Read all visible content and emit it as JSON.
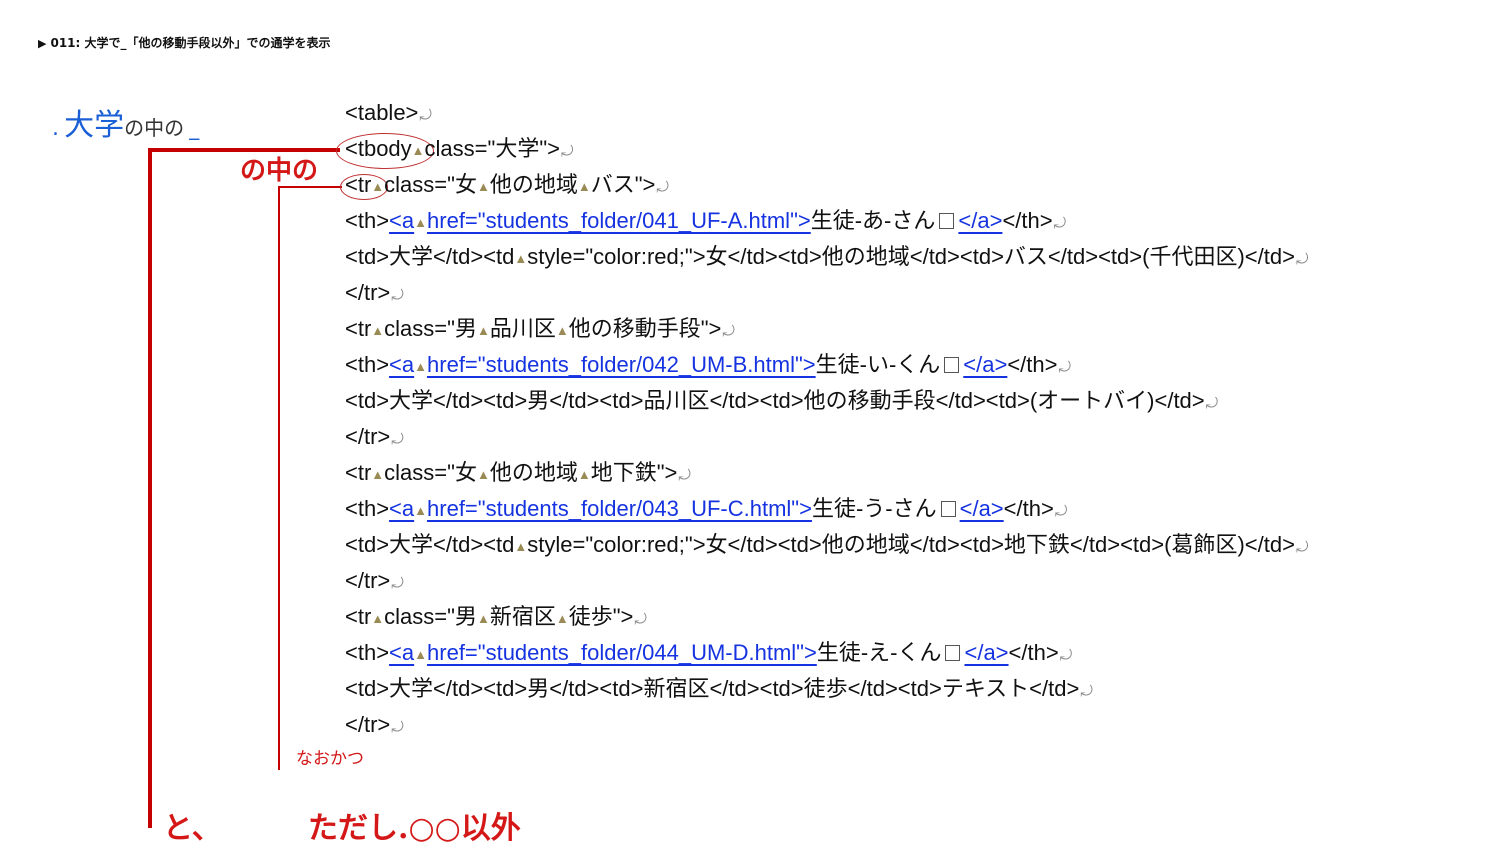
{
  "header": {
    "marker": "▶",
    "title": "011: 大学で_「他の移動手段以外」での通学を表示"
  },
  "annotations": {
    "top": {
      "dot": ".",
      "big": "大学",
      "small": "の中の",
      "underscore": "_"
    },
    "nakano": "の中の",
    "naokatsu": "なおかつ",
    "to": "と、",
    "tadashi": "ただし.○○以外"
  },
  "code_lines": [
    [
      {
        "t": "<table>"
      },
      {
        "r": 1
      }
    ],
    [
      {
        "t": "<tbody"
      },
      {
        "s": 1
      },
      {
        "t": "class=\"大学\">"
      },
      {
        "r": 1
      }
    ],
    [
      {
        "t": "<tr"
      },
      {
        "s": 1
      },
      {
        "t": "class=\"女"
      },
      {
        "s": 1
      },
      {
        "t": "他の地域"
      },
      {
        "s": 1
      },
      {
        "t": "バス\">"
      },
      {
        "r": 1
      }
    ],
    [
      {
        "t": "<th>"
      },
      {
        "l": "<a"
      },
      {
        "s": 1
      },
      {
        "l": "href=\"students_folder/041_UF-A.html\">"
      },
      {
        "t": "生徒-あ-さん"
      },
      {
        "b": 1
      },
      {
        "l": "</a>"
      },
      {
        "t": "</th>"
      },
      {
        "r": 1
      }
    ],
    [
      {
        "t": "<td>大学</td><td"
      },
      {
        "s": 1
      },
      {
        "t": "style=\"color:red;\">女</td><td>他の地域</td><td>バス</td><td>(千代田区)</td>"
      },
      {
        "r": 1
      }
    ],
    [
      {
        "t": "</tr>"
      },
      {
        "r": 1
      }
    ],
    [
      {
        "t": "<tr"
      },
      {
        "s": 1
      },
      {
        "t": "class=\"男"
      },
      {
        "s": 1
      },
      {
        "t": "品川区"
      },
      {
        "s": 1
      },
      {
        "t": "他の移動手段\">"
      },
      {
        "r": 1
      }
    ],
    [
      {
        "t": "<th>"
      },
      {
        "l": "<a"
      },
      {
        "s": 1
      },
      {
        "l": "href=\"students_folder/042_UM-B.html\">"
      },
      {
        "t": "生徒-い-くん"
      },
      {
        "b": 1
      },
      {
        "l": "</a>"
      },
      {
        "t": "</th>"
      },
      {
        "r": 1
      }
    ],
    [
      {
        "t": "<td>大学</td><td>男</td><td>品川区</td><td>他の移動手段</td><td>(オートバイ)</td>"
      },
      {
        "r": 1
      }
    ],
    [
      {
        "t": "</tr>"
      },
      {
        "r": 1
      }
    ],
    [
      {
        "t": "<tr"
      },
      {
        "s": 1
      },
      {
        "t": "class=\"女"
      },
      {
        "s": 1
      },
      {
        "t": "他の地域"
      },
      {
        "s": 1
      },
      {
        "t": "地下鉄\">"
      },
      {
        "r": 1
      }
    ],
    [
      {
        "t": "<th>"
      },
      {
        "l": "<a"
      },
      {
        "s": 1
      },
      {
        "l": "href=\"students_folder/043_UF-C.html\">"
      },
      {
        "t": "生徒-う-さん"
      },
      {
        "b": 1
      },
      {
        "l": "</a>"
      },
      {
        "t": "</th>"
      },
      {
        "r": 1
      }
    ],
    [
      {
        "t": "<td>大学</td><td"
      },
      {
        "s": 1
      },
      {
        "t": "style=\"color:red;\">女</td><td>他の地域</td><td>地下鉄</td><td>(葛飾区)</td>"
      },
      {
        "r": 1
      }
    ],
    [
      {
        "t": "</tr>"
      },
      {
        "r": 1
      }
    ],
    [
      {
        "t": "<tr"
      },
      {
        "s": 1
      },
      {
        "t": "class=\"男"
      },
      {
        "s": 1
      },
      {
        "t": "新宿区"
      },
      {
        "s": 1
      },
      {
        "t": "徒歩\">"
      },
      {
        "r": 1
      }
    ],
    [
      {
        "t": "<th>"
      },
      {
        "l": "<a"
      },
      {
        "s": 1
      },
      {
        "l": "href=\"students_folder/044_UM-D.html\">"
      },
      {
        "t": "生徒-え-くん"
      },
      {
        "b": 1
      },
      {
        "l": "</a>"
      },
      {
        "t": "</th>"
      },
      {
        "r": 1
      }
    ],
    [
      {
        "t": "<td>大学</td><td>男</td><td>新宿区</td><td>徒歩</td><td>テキスト</td>"
      },
      {
        "r": 1
      }
    ],
    [
      {
        "t": "</tr>"
      },
      {
        "r": 1
      }
    ]
  ],
  "glyphs": {
    "space_marker": "▲",
    "return_marker": "⤾"
  }
}
